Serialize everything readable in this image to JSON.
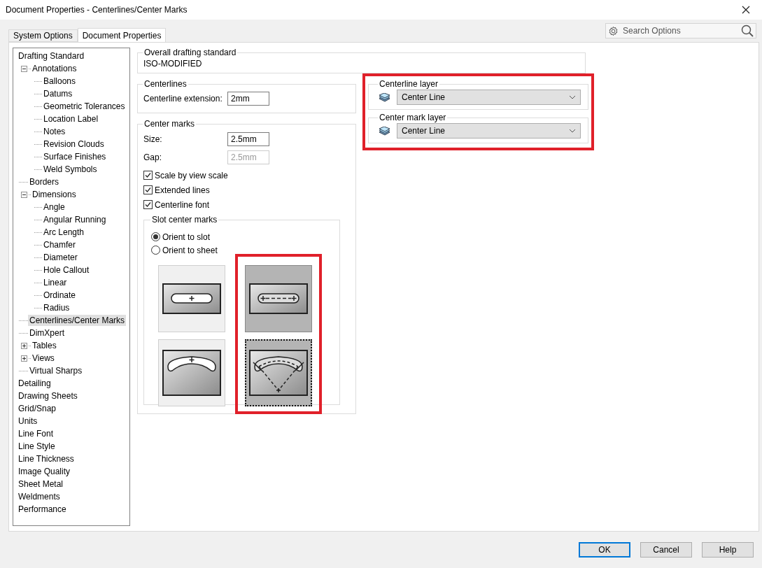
{
  "window": {
    "title": "Document Properties - Centerlines/Center Marks"
  },
  "tabs": [
    {
      "label": "System Options",
      "selected": false
    },
    {
      "label": "Document Properties",
      "selected": true
    }
  ],
  "search": {
    "placeholder": "Search Options"
  },
  "tree": [
    {
      "label": "Drafting Standard",
      "selected": false,
      "children": [
        {
          "label": "Annotations",
          "selected": false,
          "expanded": true,
          "children": [
            {
              "label": "Balloons",
              "selected": false
            },
            {
              "label": "Datums",
              "selected": false
            },
            {
              "label": "Geometric Tolerances",
              "selected": false
            },
            {
              "label": "Location Label",
              "selected": false
            },
            {
              "label": "Notes",
              "selected": false
            },
            {
              "label": "Revision Clouds",
              "selected": false
            },
            {
              "label": "Surface Finishes",
              "selected": false
            },
            {
              "label": "Weld Symbols",
              "selected": false
            }
          ]
        },
        {
          "label": "Borders",
          "selected": false
        },
        {
          "label": "Dimensions",
          "selected": false,
          "expanded": true,
          "children": [
            {
              "label": "Angle",
              "selected": false
            },
            {
              "label": "Angular Running",
              "selected": false
            },
            {
              "label": "Arc Length",
              "selected": false
            },
            {
              "label": "Chamfer",
              "selected": false
            },
            {
              "label": "Diameter",
              "selected": false
            },
            {
              "label": "Hole Callout",
              "selected": false
            },
            {
              "label": "Linear",
              "selected": false
            },
            {
              "label": "Ordinate",
              "selected": false
            },
            {
              "label": "Radius",
              "selected": false
            }
          ]
        },
        {
          "label": "Centerlines/Center Marks",
          "selected": true
        },
        {
          "label": "DimXpert",
          "selected": false
        },
        {
          "label": "Tables",
          "selected": false,
          "expanded": false
        },
        {
          "label": "Views",
          "selected": false,
          "expanded": false
        },
        {
          "label": "Virtual Sharps",
          "selected": false
        }
      ]
    },
    {
      "label": "Detailing",
      "selected": false
    },
    {
      "label": "Drawing Sheets",
      "selected": false
    },
    {
      "label": "Grid/Snap",
      "selected": false
    },
    {
      "label": "Units",
      "selected": false
    },
    {
      "label": "Line Font",
      "selected": false
    },
    {
      "label": "Line Style",
      "selected": false
    },
    {
      "label": "Line Thickness",
      "selected": false
    },
    {
      "label": "Image Quality",
      "selected": false
    },
    {
      "label": "Sheet Metal",
      "selected": false
    },
    {
      "label": "Weldments",
      "selected": false
    },
    {
      "label": "Performance",
      "selected": false
    }
  ],
  "overall_drafting_standard": {
    "title": "Overall drafting standard",
    "value": "ISO-MODIFIED"
  },
  "centerlines": {
    "title": "Centerlines",
    "fields": [
      {
        "label": "Centerline extension:",
        "value": "2mm",
        "disabled": false
      }
    ]
  },
  "center_marks": {
    "title": "Center marks",
    "fields": [
      {
        "label": "Size:",
        "value": "2.5mm",
        "disabled": false
      },
      {
        "label": "Gap:",
        "value": "2.5mm",
        "disabled": true
      }
    ],
    "checkboxes": [
      {
        "label": "Scale by view scale",
        "checked": true
      },
      {
        "label": "Extended lines",
        "checked": true
      },
      {
        "label": "Centerline font",
        "checked": true
      }
    ],
    "slot_center_marks": {
      "title": "Slot center marks",
      "options": [
        {
          "label": "Orient to slot",
          "selected": true
        },
        {
          "label": "Orient to sheet",
          "selected": false
        }
      ],
      "columns": [
        {
          "highlighted": false,
          "styles": [
            {
              "kind": "straight-single",
              "selected": false,
              "focused": false
            },
            {
              "kind": "arc-single",
              "selected": false,
              "focused": false
            }
          ]
        },
        {
          "highlighted": true,
          "styles": [
            {
              "kind": "straight-dashed",
              "selected": true,
              "focused": false
            },
            {
              "kind": "arc-dashed",
              "selected": true,
              "focused": true
            }
          ]
        }
      ]
    }
  },
  "layers": {
    "highlighted": true,
    "groups": [
      {
        "title": "Centerline layer",
        "value": "Center Line"
      },
      {
        "title": "Center mark layer",
        "value": "Center Line"
      }
    ]
  },
  "buttons": [
    {
      "label": "OK",
      "default": true
    },
    {
      "label": "Cancel",
      "default": false
    },
    {
      "label": "Help",
      "default": false
    }
  ]
}
